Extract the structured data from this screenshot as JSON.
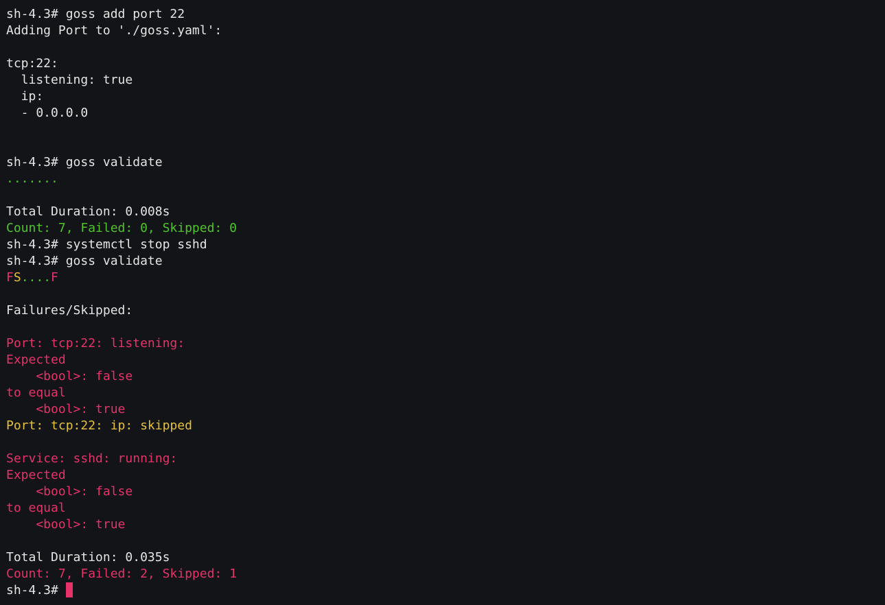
{
  "theme": {
    "background": "#131417",
    "fg": "#e5e5e5",
    "green": "#4fc52a",
    "red": "#e5336a",
    "yellow": "#e5c23a",
    "cursor": "#e5336a"
  },
  "terminal": {
    "lines": [
      [
        {
          "text": "sh-4.3# goss add port 22",
          "color": "fg"
        }
      ],
      [
        {
          "text": "Adding Port to './goss.yaml':",
          "color": "fg"
        }
      ],
      [],
      [
        {
          "text": "tcp:22:",
          "color": "fg"
        }
      ],
      [
        {
          "text": "  listening: true",
          "color": "fg"
        }
      ],
      [
        {
          "text": "  ip:",
          "color": "fg"
        }
      ],
      [
        {
          "text": "  - 0.0.0.0",
          "color": "fg"
        }
      ],
      [],
      [],
      [
        {
          "text": "sh-4.3# goss validate",
          "color": "fg"
        }
      ],
      [
        {
          "text": ".......",
          "color": "green"
        }
      ],
      [],
      [
        {
          "text": "Total Duration: 0.008s",
          "color": "fg"
        }
      ],
      [
        {
          "text": "Count: 7, Failed: 0, Skipped: 0",
          "color": "green"
        }
      ],
      [
        {
          "text": "sh-4.3# systemctl stop sshd",
          "color": "fg"
        }
      ],
      [
        {
          "text": "sh-4.3# goss validate",
          "color": "fg"
        }
      ],
      [
        {
          "text": "F",
          "color": "red"
        },
        {
          "text": "S",
          "color": "yellow"
        },
        {
          "text": "....",
          "color": "green"
        },
        {
          "text": "F",
          "color": "red"
        }
      ],
      [],
      [
        {
          "text": "Failures/Skipped:",
          "color": "fg"
        }
      ],
      [],
      [
        {
          "text": "Port: tcp:22: listening:",
          "color": "red"
        }
      ],
      [
        {
          "text": "Expected",
          "color": "red"
        }
      ],
      [
        {
          "text": "    <bool>: false",
          "color": "red"
        }
      ],
      [
        {
          "text": "to equal",
          "color": "red"
        }
      ],
      [
        {
          "text": "    <bool>: true",
          "color": "red"
        }
      ],
      [
        {
          "text": "Port: tcp:22: ip: skipped",
          "color": "yellow"
        }
      ],
      [],
      [
        {
          "text": "Service: sshd: running:",
          "color": "red"
        }
      ],
      [
        {
          "text": "Expected",
          "color": "red"
        }
      ],
      [
        {
          "text": "    <bool>: false",
          "color": "red"
        }
      ],
      [
        {
          "text": "to equal",
          "color": "red"
        }
      ],
      [
        {
          "text": "    <bool>: true",
          "color": "red"
        }
      ],
      [],
      [
        {
          "text": "Total Duration: 0.035s",
          "color": "fg"
        }
      ],
      [
        {
          "text": "Count: 7, Failed: 2, Skipped: 1",
          "color": "red"
        }
      ]
    ],
    "prompt": "sh-4.3# "
  }
}
